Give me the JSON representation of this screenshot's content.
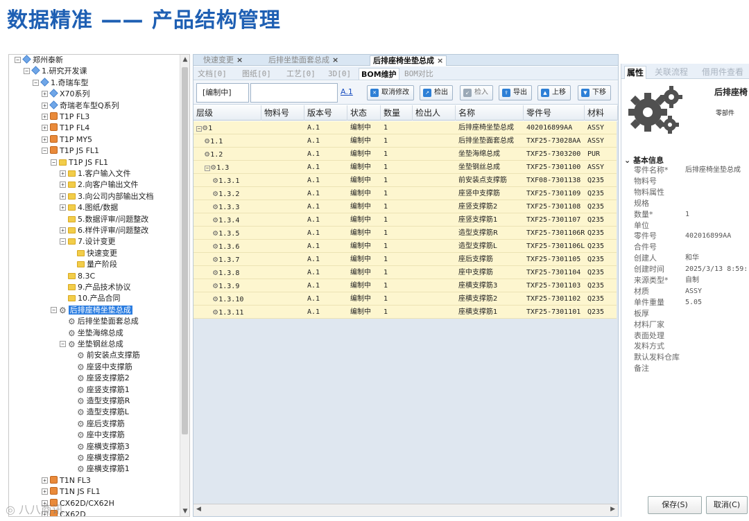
{
  "slide_title": "数据精准 —— 产品结构管理",
  "watermark": "◎ 八八商讯",
  "tree": [
    {
      "label": "郑州泰新",
      "indent": 0,
      "icon": "cube",
      "exp": "-"
    },
    {
      "label": "1.研究开发课",
      "indent": 1,
      "icon": "cube",
      "exp": "-"
    },
    {
      "label": "1.奇瑞车型",
      "indent": 2,
      "icon": "cube",
      "exp": "-"
    },
    {
      "label": "X70系列",
      "indent": 3,
      "icon": "cube",
      "exp": "+"
    },
    {
      "label": "奇瑞老车型Q系列",
      "indent": 3,
      "icon": "cube",
      "exp": "+"
    },
    {
      "label": "T1P FL3",
      "indent": 3,
      "icon": "box",
      "exp": "+"
    },
    {
      "label": "T1P FL4",
      "indent": 3,
      "icon": "box",
      "exp": "+"
    },
    {
      "label": "T1P MY5",
      "indent": 3,
      "icon": "box",
      "exp": "+"
    },
    {
      "label": "T1P JS FL1",
      "indent": 3,
      "icon": "box",
      "exp": "-"
    },
    {
      "label": "T1P JS FL1",
      "indent": 4,
      "icon": "folder",
      "exp": "-"
    },
    {
      "label": "1.客户输入文件",
      "indent": 5,
      "icon": "folder",
      "exp": "+"
    },
    {
      "label": "2.向客户输出文件",
      "indent": 5,
      "icon": "folder",
      "exp": "+"
    },
    {
      "label": "3.向公司内部输出文档",
      "indent": 5,
      "icon": "folder",
      "exp": "+"
    },
    {
      "label": "4.图纸/数据",
      "indent": 5,
      "icon": "folder",
      "exp": "+"
    },
    {
      "label": "5.数据评审/问题整改",
      "indent": 5,
      "icon": "folder",
      "exp": ""
    },
    {
      "label": "6.样件评审/问题整改",
      "indent": 5,
      "icon": "folder",
      "exp": "+"
    },
    {
      "label": "7.设计变更",
      "indent": 5,
      "icon": "folder",
      "exp": "-"
    },
    {
      "label": "快速变更",
      "indent": 6,
      "icon": "folder",
      "exp": ""
    },
    {
      "label": "量产阶段",
      "indent": 6,
      "icon": "folder",
      "exp": ""
    },
    {
      "label": "8.3C",
      "indent": 5,
      "icon": "folder",
      "exp": ""
    },
    {
      "label": "9.产品技术协议",
      "indent": 5,
      "icon": "folder",
      "exp": ""
    },
    {
      "label": "10.产品合同",
      "indent": 5,
      "icon": "folder",
      "exp": ""
    },
    {
      "label": "后排座椅坐垫总成",
      "indent": 4,
      "icon": "gear",
      "exp": "-",
      "selected": true
    },
    {
      "label": "后排坐垫面套总成",
      "indent": 5,
      "icon": "gear",
      "exp": ""
    },
    {
      "label": "坐垫海绵总成",
      "indent": 5,
      "icon": "gear",
      "exp": ""
    },
    {
      "label": "坐垫钢丝总成",
      "indent": 5,
      "icon": "gear",
      "exp": "-"
    },
    {
      "label": "前安装点支撑筋",
      "indent": 6,
      "icon": "gear",
      "exp": ""
    },
    {
      "label": "座竖中支撑筋",
      "indent": 6,
      "icon": "gear",
      "exp": ""
    },
    {
      "label": "座竖支撑筋2",
      "indent": 6,
      "icon": "gear",
      "exp": ""
    },
    {
      "label": "座竖支撑筋1",
      "indent": 6,
      "icon": "gear",
      "exp": ""
    },
    {
      "label": "造型支撑筋R",
      "indent": 6,
      "icon": "gear",
      "exp": ""
    },
    {
      "label": "造型支撑筋L",
      "indent": 6,
      "icon": "gear",
      "exp": ""
    },
    {
      "label": "座后支撑筋",
      "indent": 6,
      "icon": "gear",
      "exp": ""
    },
    {
      "label": "座中支撑筋",
      "indent": 6,
      "icon": "gear",
      "exp": ""
    },
    {
      "label": "座横支撑筋3",
      "indent": 6,
      "icon": "gear",
      "exp": ""
    },
    {
      "label": "座横支撑筋2",
      "indent": 6,
      "icon": "gear",
      "exp": ""
    },
    {
      "label": "座横支撑筋1",
      "indent": 6,
      "icon": "gear",
      "exp": ""
    },
    {
      "label": "T1N FL3",
      "indent": 3,
      "icon": "box",
      "exp": "+"
    },
    {
      "label": "T1N JS FL1",
      "indent": 3,
      "icon": "box",
      "exp": "+"
    },
    {
      "label": "CX62D/CX62H",
      "indent": 3,
      "icon": "box",
      "exp": "+"
    },
    {
      "label": "CX62D",
      "indent": 3,
      "icon": "box",
      "exp": "+"
    }
  ],
  "doc_tabs": [
    {
      "label": "快速变更",
      "active": false
    },
    {
      "label": "后排坐垫面套总成",
      "active": false
    },
    {
      "label": "后排座椅坐垫总成",
      "active": true
    }
  ],
  "sub_tabs": [
    "文档[0]",
    "图纸[0]",
    "工艺[0]",
    "3D[0]",
    "BOM维护",
    "BOM对比"
  ],
  "active_sub_tab": "BOM维护",
  "toolbar": {
    "status": "[编制中]",
    "version_link": "A.1",
    "buttons": [
      {
        "label": "取消修改",
        "disabled": false
      },
      {
        "label": "检出",
        "disabled": false
      },
      {
        "label": "检入",
        "disabled": true
      },
      {
        "label": "导出",
        "disabled": false
      },
      {
        "label": "上移",
        "disabled": false
      },
      {
        "label": "下移",
        "disabled": false
      }
    ]
  },
  "grid": {
    "columns": [
      "层级",
      "物料号",
      "版本号",
      "状态",
      "数量",
      "检出人",
      "名称",
      "零件号",
      "材料"
    ],
    "rows": [
      {
        "level": "1",
        "depth": 0,
        "exp": "-",
        "material_no": "",
        "version": "A.1",
        "status": "编制中",
        "qty": "1",
        "checkout": "",
        "name": "后排座椅坐垫总成",
        "part_no": "402016899AA",
        "material": "ASSY"
      },
      {
        "level": "1.1",
        "depth": 1,
        "exp": "",
        "material_no": "",
        "version": "A.1",
        "status": "编制中",
        "qty": "1",
        "checkout": "",
        "name": "后排坐垫面套总成",
        "part_no": "TXF25-73028AA",
        "material": "ASSY"
      },
      {
        "level": "1.2",
        "depth": 1,
        "exp": "",
        "material_no": "",
        "version": "A.1",
        "status": "编制中",
        "qty": "1",
        "checkout": "",
        "name": "坐垫海绵总成",
        "part_no": "TXF25-7303200",
        "material": "PUR"
      },
      {
        "level": "1.3",
        "depth": 1,
        "exp": "-",
        "material_no": "",
        "version": "A.1",
        "status": "编制中",
        "qty": "1",
        "checkout": "",
        "name": "坐垫钢丝总成",
        "part_no": "TXF25-7301100",
        "material": "ASSY"
      },
      {
        "level": "1.3.1",
        "depth": 2,
        "exp": "",
        "material_no": "",
        "version": "A.1",
        "status": "编制中",
        "qty": "1",
        "checkout": "",
        "name": "前安装点支撑筋",
        "part_no": "TXF08-7301138",
        "material": "Q235"
      },
      {
        "level": "1.3.2",
        "depth": 2,
        "exp": "",
        "material_no": "",
        "version": "A.1",
        "status": "编制中",
        "qty": "1",
        "checkout": "",
        "name": "座竖中支撑筋",
        "part_no": "TXF25-7301109",
        "material": "Q235"
      },
      {
        "level": "1.3.3",
        "depth": 2,
        "exp": "",
        "material_no": "",
        "version": "A.1",
        "status": "编制中",
        "qty": "1",
        "checkout": "",
        "name": "座竖支撑筋2",
        "part_no": "TXF25-7301108",
        "material": "Q235"
      },
      {
        "level": "1.3.4",
        "depth": 2,
        "exp": "",
        "material_no": "",
        "version": "A.1",
        "status": "编制中",
        "qty": "1",
        "checkout": "",
        "name": "座竖支撑筋1",
        "part_no": "TXF25-7301107",
        "material": "Q235"
      },
      {
        "level": "1.3.5",
        "depth": 2,
        "exp": "",
        "material_no": "",
        "version": "A.1",
        "status": "编制中",
        "qty": "1",
        "checkout": "",
        "name": "造型支撑筋R",
        "part_no": "TXF25-7301106R",
        "material": "Q235"
      },
      {
        "level": "1.3.6",
        "depth": 2,
        "exp": "",
        "material_no": "",
        "version": "A.1",
        "status": "编制中",
        "qty": "1",
        "checkout": "",
        "name": "造型支撑筋L",
        "part_no": "TXF25-7301106L",
        "material": "Q235"
      },
      {
        "level": "1.3.7",
        "depth": 2,
        "exp": "",
        "material_no": "",
        "version": "A.1",
        "status": "编制中",
        "qty": "1",
        "checkout": "",
        "name": "座后支撑筋",
        "part_no": "TXF25-7301105",
        "material": "Q235"
      },
      {
        "level": "1.3.8",
        "depth": 2,
        "exp": "",
        "material_no": "",
        "version": "A.1",
        "status": "编制中",
        "qty": "1",
        "checkout": "",
        "name": "座中支撑筋",
        "part_no": "TXF25-7301104",
        "material": "Q235"
      },
      {
        "level": "1.3.9",
        "depth": 2,
        "exp": "",
        "material_no": "",
        "version": "A.1",
        "status": "编制中",
        "qty": "1",
        "checkout": "",
        "name": "座横支撑筋3",
        "part_no": "TXF25-7301103",
        "material": "Q235"
      },
      {
        "level": "1.3.10",
        "depth": 2,
        "exp": "",
        "material_no": "",
        "version": "A.1",
        "status": "编制中",
        "qty": "1",
        "checkout": "",
        "name": "座横支撑筋2",
        "part_no": "TXF25-7301102",
        "material": "Q235"
      },
      {
        "level": "1.3.11",
        "depth": 2,
        "exp": "",
        "material_no": "",
        "version": "A.1",
        "status": "编制中",
        "qty": "1",
        "checkout": "",
        "name": "座横支撑筋1",
        "part_no": "TXF25-7301101",
        "material": "Q235"
      }
    ]
  },
  "right": {
    "tabs": [
      "属性",
      "关联流程",
      "借用件查看"
    ],
    "active_tab": "属性",
    "part_title": "后排座椅",
    "part_type": "零部件",
    "section": "基本信息",
    "props": [
      {
        "label": "零件名称*",
        "value": "后排座椅坐垫总成"
      },
      {
        "label": "物料号",
        "value": ""
      },
      {
        "label": "物料属性",
        "value": ""
      },
      {
        "label": "规格",
        "value": ""
      },
      {
        "label": "数量*",
        "value": "1"
      },
      {
        "label": "单位",
        "value": ""
      },
      {
        "label": "零件号",
        "value": "402016899AA"
      },
      {
        "label": "合件号",
        "value": ""
      },
      {
        "label": "创建人",
        "value": "和华"
      },
      {
        "label": "创建时间",
        "value": "2025/3/13 8:59:"
      },
      {
        "label": "来源类型*",
        "value": "自制"
      },
      {
        "label": "材质",
        "value": "ASSY"
      },
      {
        "label": "单件重量",
        "value": "5.05"
      },
      {
        "label": "板厚",
        "value": ""
      },
      {
        "label": "材料厂家",
        "value": ""
      },
      {
        "label": "表面处理",
        "value": ""
      },
      {
        "label": "发料方式",
        "value": ""
      },
      {
        "label": "默认发料仓库",
        "value": ""
      },
      {
        "label": "备注",
        "value": ""
      }
    ],
    "save_label": "保存(S)",
    "cancel_label": "取消(C)"
  }
}
